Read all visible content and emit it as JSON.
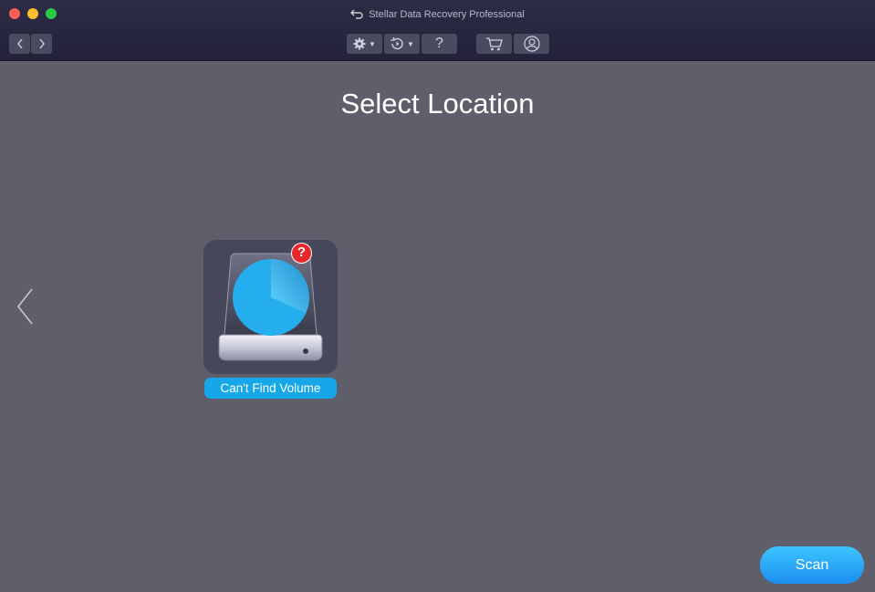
{
  "window": {
    "title": "Stellar Data Recovery Professional",
    "traffic_lights": {
      "close": "#fe5f57",
      "minimize": "#febc2e",
      "zoom": "#28c840"
    }
  },
  "toolbar": {
    "back_icon": "chevron-left-icon",
    "forward_icon": "chevron-right-icon",
    "settings_icon": "gear-icon",
    "history_icon": "clock-history-icon",
    "help_label": "?",
    "cart_icon": "cart-icon",
    "account_icon": "user-icon"
  },
  "main": {
    "heading": "Select Location",
    "volumes": [
      {
        "label": "Can't Find Volume",
        "icon": "hard-drive-icon",
        "badge": "?"
      }
    ],
    "scan_label": "Scan",
    "accent": "#15a7e8"
  }
}
